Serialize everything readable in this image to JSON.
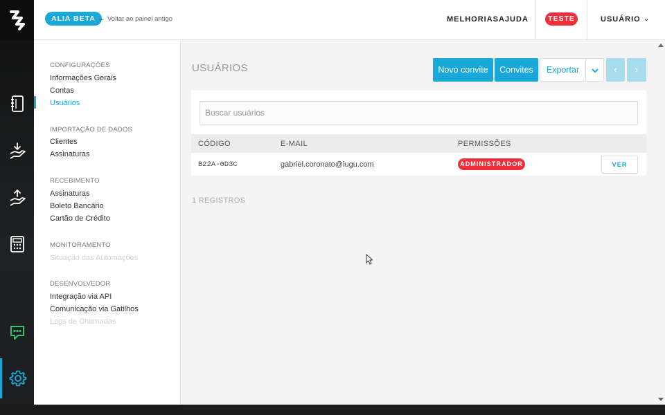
{
  "topbar": {
    "beta_badge": "ALIA BETA",
    "back_link": "Voltar ao painel antigo",
    "nav": {
      "improvements": "MELHORIAS",
      "help": "AJUDA"
    },
    "test_badge": "TESTE",
    "user_menu": "USUÁRIO"
  },
  "rail": {
    "items": [
      {
        "icon": "ledger-book-icon"
      },
      {
        "icon": "hand-deposit-icon"
      },
      {
        "icon": "hand-withdraw-icon"
      },
      {
        "icon": "calculator-icon"
      },
      {
        "icon": "chat-bot-icon",
        "color": "#3fc06f"
      },
      {
        "icon": "gear-icon",
        "color": "#19a8d8",
        "active": true
      }
    ]
  },
  "sidebar": {
    "sections": [
      {
        "title": "CONFIGURAÇÕES",
        "items": [
          "Informações Gerais",
          "Contas",
          "Usuários"
        ]
      },
      {
        "title": "IMPORTAÇÃO DE DADOS",
        "items": [
          "Clientes",
          "Assinaturas"
        ]
      },
      {
        "title": "RECEBIMENTO",
        "items": [
          "Assinaturas",
          "Boleto Bancário",
          "Cartão de Crédito"
        ]
      },
      {
        "title": "MONITORAMENTO",
        "items": [
          "Situação das Automações"
        ]
      },
      {
        "title": "DESENVOLVEDOR",
        "items": [
          "Integração via API",
          "Comunicação via Gatilhos",
          "Logs de Chamadas"
        ]
      }
    ]
  },
  "main": {
    "title": "USUÁRIOS",
    "buttons": {
      "new_invite": "Novo convite",
      "invites": "Convites",
      "export": "Exportar",
      "export_caret": "⌄",
      "prev": "‹",
      "next": "›"
    },
    "search": {
      "placeholder": "Buscar usuários",
      "value": ""
    },
    "table": {
      "headers": [
        "CÓDIGO",
        "E-MAIL",
        "PERMISSÕES"
      ],
      "rows": [
        {
          "code": "B22A-0D3C",
          "email": "gabriel.coronato@iugu.com",
          "permission": "ADMINISTRADOR",
          "action": "VER"
        }
      ]
    },
    "records": "1 REGISTROS"
  },
  "colors": {
    "accent": "#19a8d8",
    "danger": "#ef2f3a",
    "rail_bg": "#1f2224",
    "chat_icon": "#3fc06f"
  }
}
